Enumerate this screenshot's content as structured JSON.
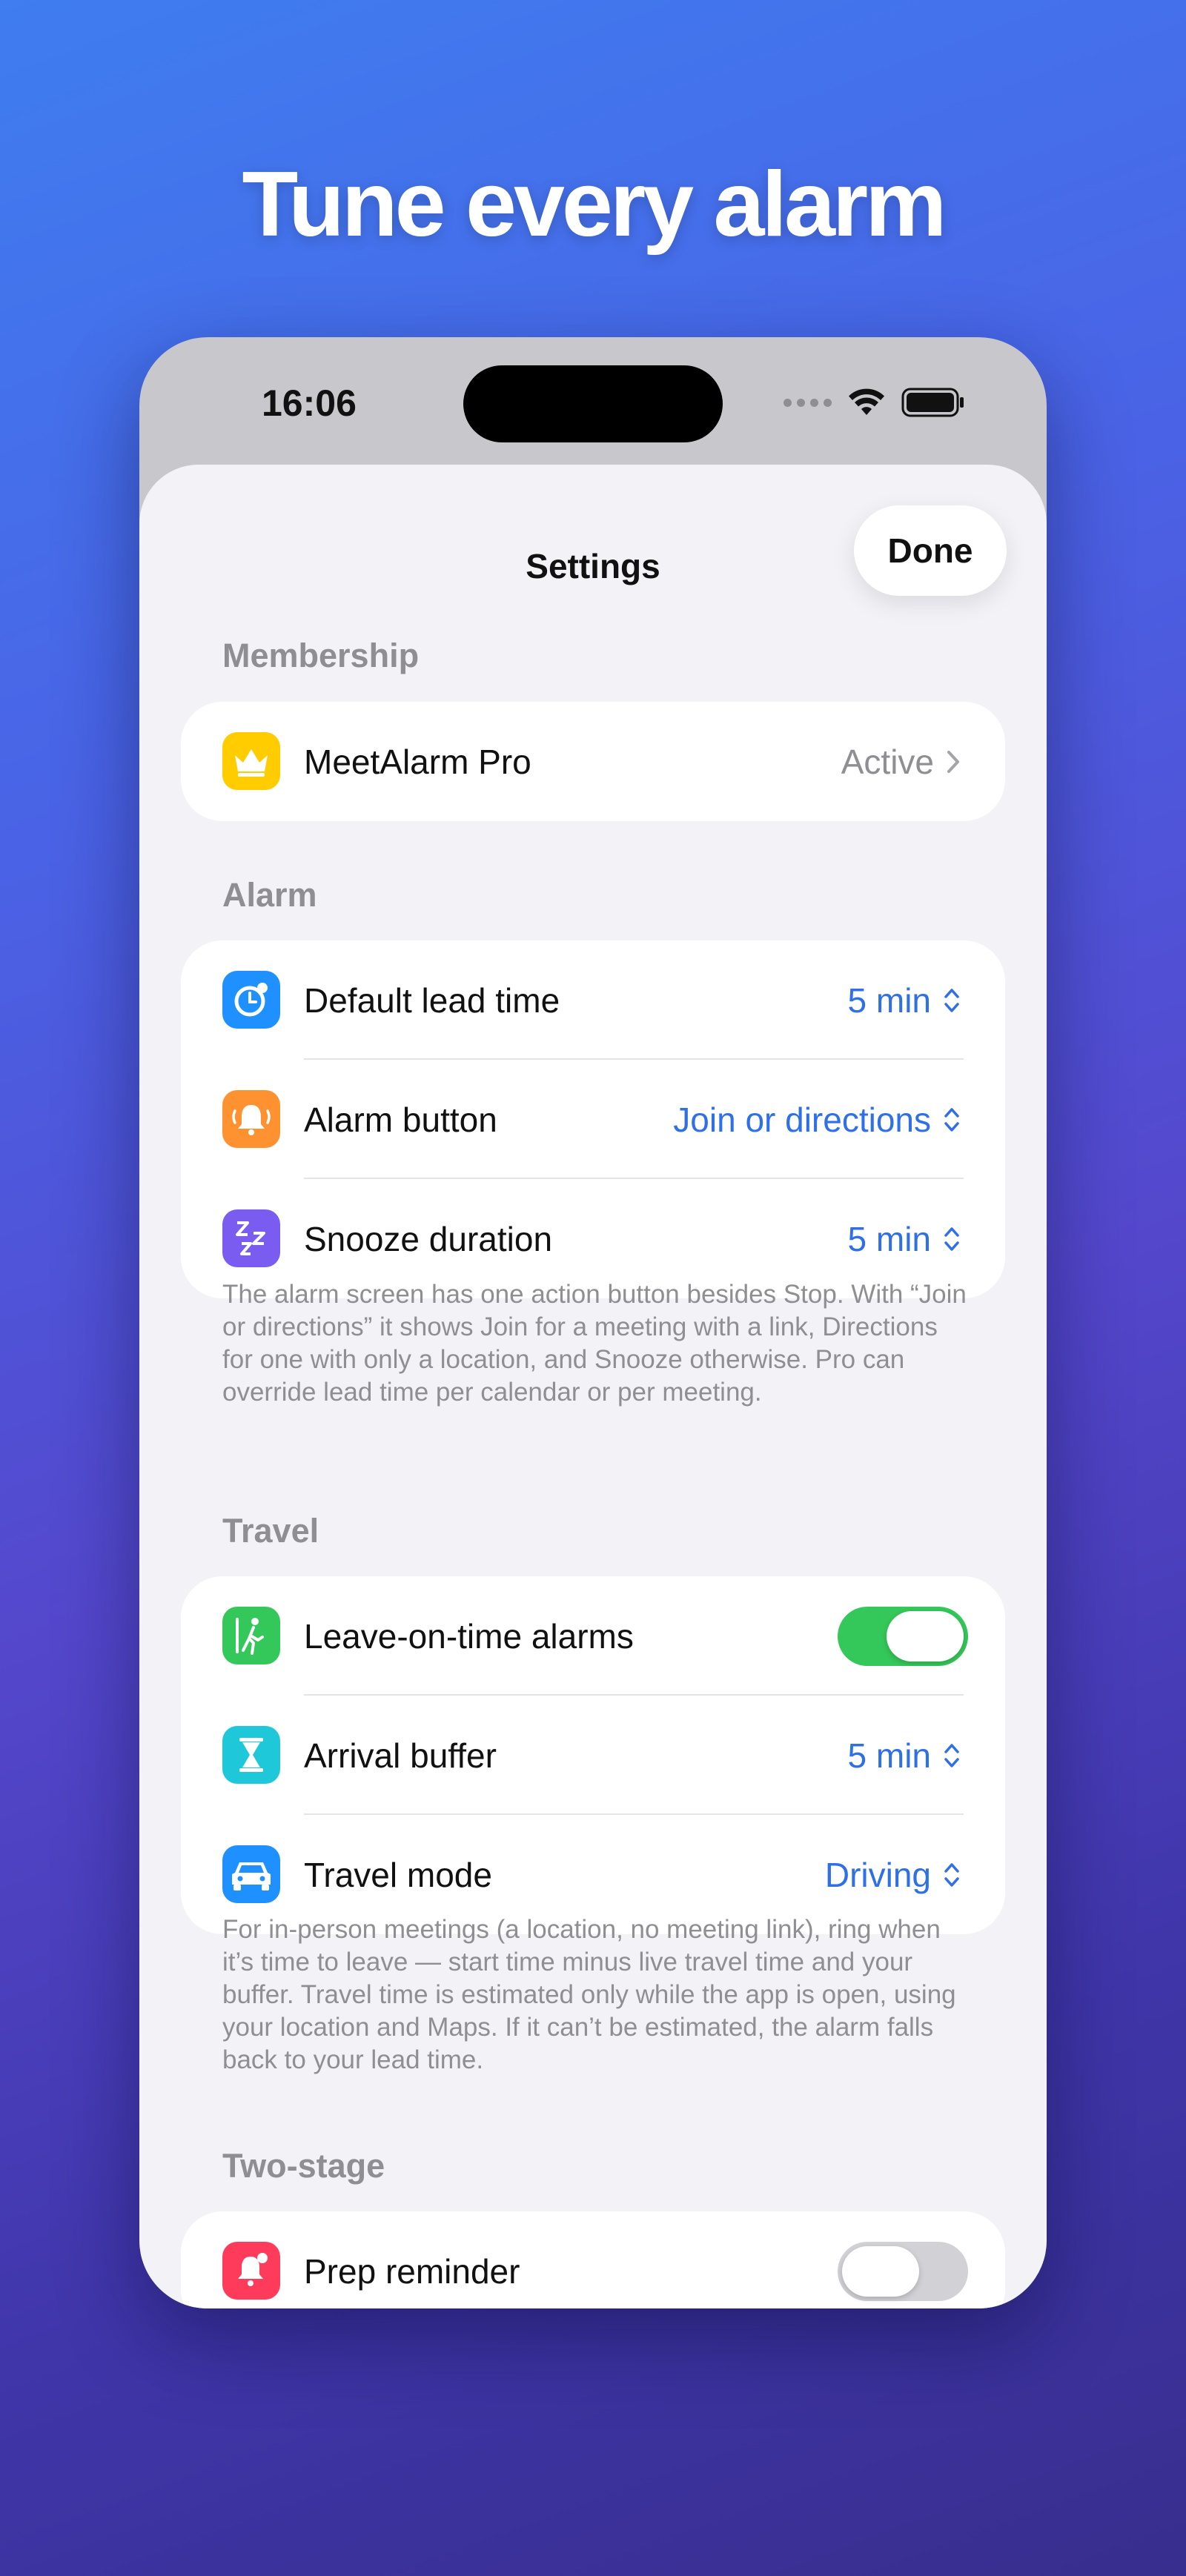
{
  "headline": "Tune every alarm",
  "status_bar": {
    "time": "16:06"
  },
  "nav": {
    "title": "Settings",
    "done_label": "Done"
  },
  "sections": {
    "membership": {
      "header": "Membership",
      "rows": [
        {
          "label": "MeetAlarm Pro",
          "value": "Active",
          "icon": "crown-icon",
          "icon_color": "#ffcc00"
        }
      ]
    },
    "alarm": {
      "header": "Alarm",
      "rows": [
        {
          "label": "Default lead time",
          "value": "5 min",
          "icon": "alarm-clock-icon",
          "icon_color": "#1e90ff"
        },
        {
          "label": "Alarm button",
          "value": "Join or directions",
          "icon": "bell-ringing-icon",
          "icon_color": "#ff9230"
        },
        {
          "label": "Snooze duration",
          "value": "5 min",
          "icon": "zzz-icon",
          "icon_color": "#7b5cf0"
        }
      ],
      "footnote": "The alarm screen has one action button besides Stop. With “Join or directions” it shows Join for a meeting with a link, Directions for one with only a location, and Snooze otherwise. Pro can override lead time per calendar or per meeting."
    },
    "travel": {
      "header": "Travel",
      "rows": [
        {
          "label": "Leave-on-time alarms",
          "toggle": true,
          "icon": "walking-person-icon",
          "icon_color": "#34c759"
        },
        {
          "label": "Arrival buffer",
          "value": "5 min",
          "icon": "hourglass-icon",
          "icon_color": "#1ec8d8"
        },
        {
          "label": "Travel mode",
          "value": "Driving",
          "icon": "car-icon",
          "icon_color": "#1e90ff"
        }
      ],
      "footnote": "For in-person meetings (a location, no meeting link), ring when it’s time to leave — start time minus live travel time and your buffer. Travel time is estimated only while the app is open, using your location and Maps. If it can’t be estimated, the alarm falls back to your lead time."
    },
    "two_stage": {
      "header": "Two-stage",
      "rows": [
        {
          "label": "Prep reminder",
          "toggle": false,
          "icon": "bell-badge-icon",
          "icon_color": "#ff3b5c"
        }
      ]
    }
  },
  "colors": {
    "accent": "#2f6fe8",
    "toggle_on": "#34c759",
    "toggle_off": "#d1d1d6"
  }
}
